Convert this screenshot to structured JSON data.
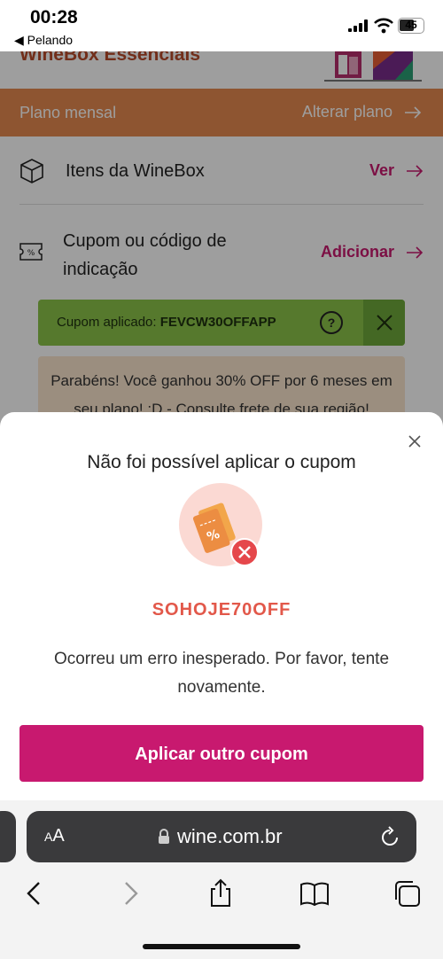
{
  "status_bar": {
    "time": "00:28",
    "back_app": "◀ Pelando",
    "battery": "45"
  },
  "background_page": {
    "title": "WineBox Essenciais",
    "plan_label": "Plano mensal",
    "plan_change": "Alterar plano",
    "items_label": "Itens da WineBox",
    "items_link": "Ver",
    "coupon_label_line1": "Cupom ou código de",
    "coupon_label_line2": "indicação",
    "coupon_link": "Adicionar",
    "coupon_applied_prefix": "Cupom aplicado:",
    "coupon_applied_code": "FEVCW30OFFAPP",
    "congrats_line1": "Parabéns! Você ganhou 30% OFF por 6 meses em",
    "congrats_line2": "seu plano! :D - Consulte frete de sua região!"
  },
  "modal": {
    "title": "Não foi possível aplicar o cupom",
    "code": "SOHOJE70OFF",
    "message": "Ocorreu um erro inesperado. Por favor, tente novamente.",
    "button_label": "Aplicar outro cupom"
  },
  "browser": {
    "text_size_label_small": "A",
    "text_size_label_large": "A",
    "url": "wine.com.br"
  },
  "colors": {
    "accent": "#c8196f",
    "error": "#e2584a",
    "plan_bar": "#e68a4f",
    "coupon_success": "#8bc34a"
  },
  "icons": [
    "signal-icon",
    "wifi-icon",
    "battery-icon",
    "arrow-right-icon",
    "box-icon",
    "coupon-ticket-icon",
    "help-icon",
    "close-icon",
    "coupon-error-icon",
    "lock-icon",
    "reload-icon",
    "back-icon",
    "forward-icon",
    "share-icon",
    "bookmarks-icon",
    "tabs-icon"
  ]
}
